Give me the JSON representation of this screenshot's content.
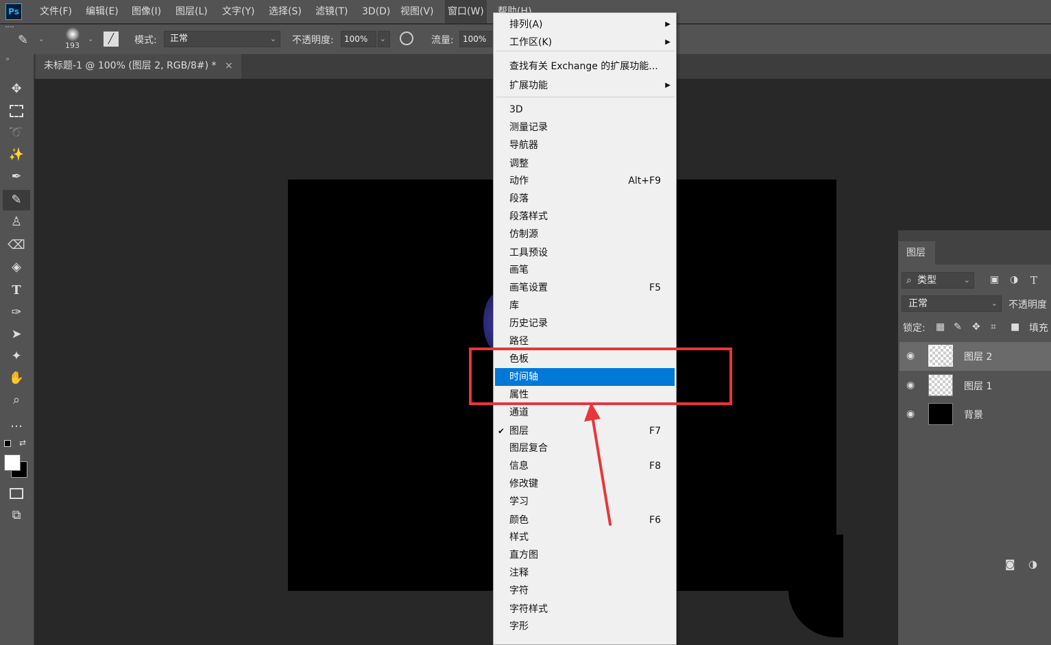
{
  "app": {
    "logo_text": "Ps"
  },
  "menubar": {
    "items": [
      "文件(F)",
      "编辑(E)",
      "图像(I)",
      "图层(L)",
      "文字(Y)",
      "选择(S)",
      "滤镜(T)",
      "3D(D)",
      "视图(V)",
      "窗口(W)",
      "帮助(H)"
    ],
    "active": "窗口(W)"
  },
  "options": {
    "brush_size": "193",
    "mode_label": "模式:",
    "mode_value": "正常",
    "opacity_label": "不透明度:",
    "opacity_value": "100%",
    "flow_label": "流量:",
    "flow_value": "100%"
  },
  "document": {
    "tab_title": "未标题-1 @ 100% (图层 2, RGB/8#) *",
    "close_glyph": "×"
  },
  "window_menu": {
    "items": [
      {
        "label": "排列(A)",
        "submenu": true
      },
      {
        "label": "工作区(K)",
        "submenu": true
      },
      {
        "sep": true
      },
      {
        "label": "查找有关 Exchange 的扩展功能..."
      },
      {
        "label": "扩展功能",
        "submenu": true
      },
      {
        "sep": true
      },
      {
        "label": "3D"
      },
      {
        "label": "测量记录"
      },
      {
        "label": "导航器"
      },
      {
        "label": "调整"
      },
      {
        "label": "动作",
        "shortcut": "Alt+F9"
      },
      {
        "label": "段落"
      },
      {
        "label": "段落样式"
      },
      {
        "label": "仿制源"
      },
      {
        "label": "工具预设"
      },
      {
        "label": "画笔"
      },
      {
        "label": "画笔设置",
        "shortcut": "F5"
      },
      {
        "label": "库"
      },
      {
        "label": "历史记录"
      },
      {
        "label": "路径"
      },
      {
        "label": "色板"
      },
      {
        "label": "时间轴",
        "highlighted": true
      },
      {
        "label": "属性"
      },
      {
        "label": "通道"
      },
      {
        "label": "图层",
        "shortcut": "F7",
        "checked": true
      },
      {
        "label": "图层复合"
      },
      {
        "label": "信息",
        "shortcut": "F8"
      },
      {
        "label": "修改键"
      },
      {
        "label": "学习"
      },
      {
        "label": "颜色",
        "shortcut": "F6"
      },
      {
        "label": "样式"
      },
      {
        "label": "直方图"
      },
      {
        "label": "注释"
      },
      {
        "label": "字符"
      },
      {
        "label": "字符样式"
      },
      {
        "label": "字形"
      }
    ]
  },
  "layers_panel": {
    "tab_label": "图层",
    "filter_label": "类型",
    "blend_mode": "正常",
    "opacity_label": "不透明度",
    "lock_label": "锁定:",
    "fill_label": "填充",
    "layers": [
      {
        "name": "图层 2",
        "selected": true,
        "thumb": "checker"
      },
      {
        "name": "图层 1",
        "selected": false,
        "thumb": "checker"
      },
      {
        "name": "背景",
        "selected": false,
        "thumb": "black"
      }
    ]
  },
  "colors": {
    "highlight": "#0078d7",
    "annotation": "#e8363a",
    "ui_gray": "#535353"
  },
  "icons": [
    "move-icon",
    "marquee-icon",
    "lasso-icon",
    "magic-wand-icon",
    "eyedropper-icon",
    "brush-icon",
    "stamp-icon",
    "eraser-icon",
    "paint-bucket-icon",
    "type-icon",
    "pen-icon",
    "path-select-icon",
    "shape-icon",
    "hand-icon",
    "zoom-icon",
    "more-icon"
  ]
}
